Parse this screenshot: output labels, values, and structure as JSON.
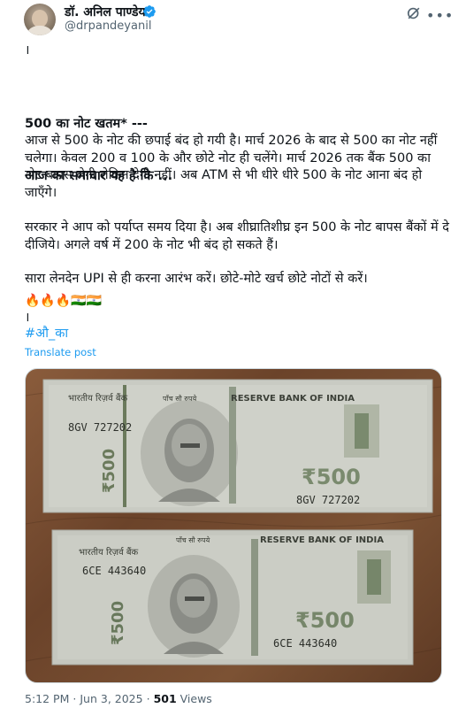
{
  "author": {
    "name": "डॉ. अनिल पाण्डेय",
    "handle": "@drpandeyanil"
  },
  "post": {
    "line1": "।",
    "headline1": "500 का नोट खतम* ---",
    "headline2": "आज का समाचार यह है कि ...",
    "para1": "आज से 500 के नोट की छपाई बंद हो गयी है। मार्च 2026 के बाद से 500 का नोट नहीं चलेगा। केवल 200 व 100 के और छोटे नोट ही चलेंगे। मार्च 2026 तक बैंक 500 का नोट बापस लेगी लेकिन देगी नहीं। अब ATM से भी धीरे धीरे 500 के नोट आना बंद हो जाएँगे।",
    "para2": "सरकार ने आप को पर्याप्त समय दिया है। अब शीघ्रातिशीघ्र इन 500 के नोट बापस बैंकों में दे दीजिये। अगले वर्ष में 200 के नोट भी बंद हो सकते हैं।",
    "para3": "सारा लेनदेन UPI से ही करना आरंभ करें। छोटे-मोटे खर्च छोटे नोटों से करें।",
    "emojis": "🔥🔥🔥🇮🇳🇮🇳",
    "line2": "।",
    "hashtag": "#औ_का",
    "translate": "Translate post"
  },
  "note1": {
    "bank_hindi": "भारतीय रिज़र्व बैंक",
    "denomination_hindi": "पाँच सौ रुपये",
    "bank_english": "RESERVE BANK OF INDIA",
    "serial": "8GV 727202",
    "value": "₹500",
    "side_value": "₹500"
  },
  "note2": {
    "bank_hindi": "भारतीय रिज़र्व बैंक",
    "denomination_hindi": "पाँच सौ रुपये",
    "bank_english": "RESERVE BANK OF INDIA",
    "serial": "6CE 443640",
    "value": "₹500",
    "side_value": "₹500"
  },
  "meta": {
    "time": "5:12 PM",
    "date": "Jun 3, 2025",
    "views_count": "501",
    "views_label": "Views"
  },
  "colors": {
    "link": "#1d9bf0",
    "muted": "#536471",
    "verified": "#1d9bf0",
    "note_body": "#c9cbc3",
    "note_green": "#7a8a6e"
  }
}
